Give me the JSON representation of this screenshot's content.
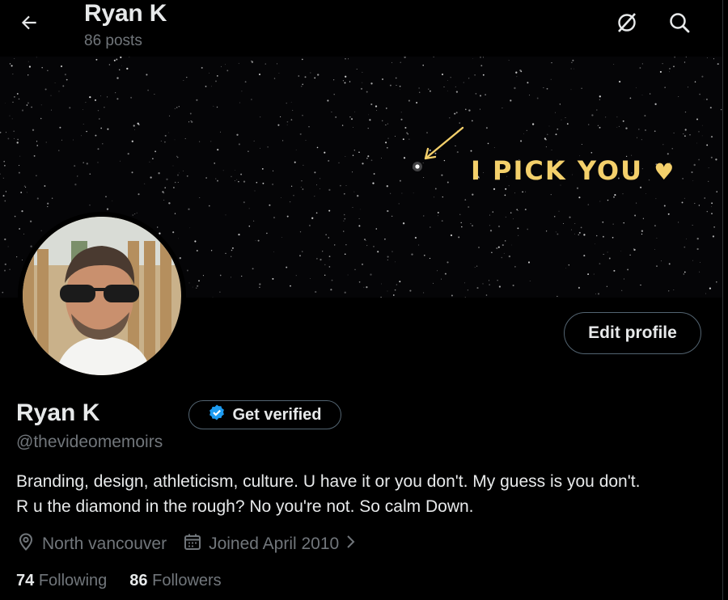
{
  "header": {
    "title": "Ryan K",
    "post_count": "86 posts"
  },
  "banner": {
    "text": "I PICK YOU",
    "heart": "♥"
  },
  "profile": {
    "edit_label": "Edit profile",
    "name": "Ryan K",
    "verify_label": "Get verified",
    "handle": "@thevideomemoirs",
    "bio_line1": "Branding, design, athleticism, culture. U have it or you don't. My guess is you don't.",
    "bio_line2": "R u the diamond in the rough? No you're not. So calm Down.",
    "location": "North vancouver",
    "joined": "Joined April 2010",
    "following_count": "74",
    "following_label": "Following",
    "followers_count": "86",
    "followers_label": "Followers"
  },
  "colors": {
    "background": "#000000",
    "primary_text": "#e7e9ea",
    "secondary_text": "#71767b",
    "verified_blue": "#1d9bf0",
    "banner_accent": "#f4d06b"
  },
  "icons": [
    "back-arrow-icon",
    "grok-icon",
    "search-icon",
    "verified-badge-icon",
    "location-pin-icon",
    "calendar-icon",
    "chevron-right-icon"
  ]
}
